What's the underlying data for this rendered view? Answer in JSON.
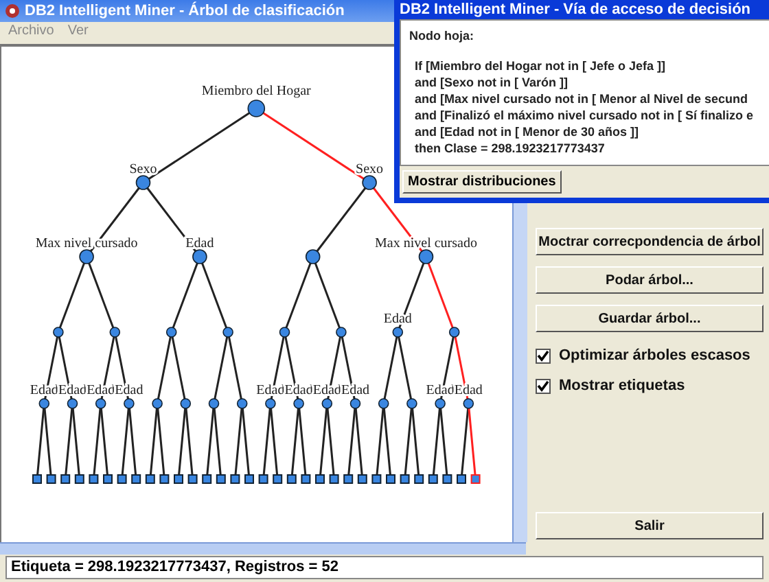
{
  "window": {
    "title": "DB2 Intelligent Miner - Árbol de clasificación"
  },
  "menu": [
    "Archivo",
    "Ver"
  ],
  "tree": {
    "label": "Miembro del Hogar",
    "children": [
      {
        "label": "Sexo",
        "path": false,
        "children": [
          {
            "label": "Max nivel cursado",
            "path": false,
            "children": [
              {
                "path": false,
                "children": [
                  {
                    "label": "Edad",
                    "path": false,
                    "children": [
                      {
                        "path": false
                      },
                      {
                        "path": false
                      }
                    ]
                  },
                  {
                    "label": "Edad",
                    "path": false,
                    "children": [
                      {
                        "path": false
                      },
                      {
                        "path": false
                      }
                    ]
                  }
                ]
              },
              {
                "path": false,
                "children": [
                  {
                    "label": "Edad",
                    "path": false,
                    "children": [
                      {
                        "path": false
                      },
                      {
                        "path": false
                      }
                    ]
                  },
                  {
                    "label": "Edad",
                    "path": false,
                    "children": [
                      {
                        "path": false
                      },
                      {
                        "path": false
                      }
                    ]
                  }
                ]
              }
            ]
          },
          {
            "label": "Edad",
            "path": false,
            "children": [
              {
                "path": false,
                "children": [
                  {
                    "path": false,
                    "children": [
                      {
                        "path": false
                      },
                      {
                        "path": false
                      }
                    ]
                  },
                  {
                    "path": false,
                    "children": [
                      {
                        "path": false
                      },
                      {
                        "path": false
                      }
                    ]
                  }
                ]
              },
              {
                "path": false,
                "children": [
                  {
                    "path": false,
                    "children": [
                      {
                        "path": false
                      },
                      {
                        "path": false
                      }
                    ]
                  },
                  {
                    "path": false,
                    "children": [
                      {
                        "path": false
                      },
                      {
                        "path": false
                      }
                    ]
                  }
                ]
              }
            ]
          }
        ]
      },
      {
        "label": "Sexo",
        "path": true,
        "children": [
          {
            "path": false,
            "children": [
              {
                "path": false,
                "children": [
                  {
                    "label": "Edad",
                    "path": false,
                    "children": [
                      {
                        "path": false
                      },
                      {
                        "path": false
                      }
                    ]
                  },
                  {
                    "label": "Edad",
                    "path": false,
                    "children": [
                      {
                        "path": false
                      },
                      {
                        "path": false
                      }
                    ]
                  }
                ]
              },
              {
                "path": false,
                "children": [
                  {
                    "label": "Edad",
                    "path": false,
                    "children": [
                      {
                        "path": false
                      },
                      {
                        "path": false
                      }
                    ]
                  },
                  {
                    "label": "Edad",
                    "path": false,
                    "children": [
                      {
                        "path": false
                      },
                      {
                        "path": false
                      }
                    ]
                  }
                ]
              }
            ]
          },
          {
            "label": "Max nivel cursado",
            "path": true,
            "children": [
              {
                "label": "Edad",
                "path": false,
                "children": [
                  {
                    "path": false,
                    "children": [
                      {
                        "path": false
                      },
                      {
                        "path": false
                      }
                    ]
                  },
                  {
                    "path": false,
                    "children": [
                      {
                        "path": false
                      },
                      {
                        "path": false
                      }
                    ]
                  }
                ]
              },
              {
                "path": true,
                "children": [
                  {
                    "label": "Edad",
                    "path": false,
                    "children": [
                      {
                        "path": false
                      },
                      {
                        "path": false
                      }
                    ]
                  },
                  {
                    "label": "Edad",
                    "path": true,
                    "children": [
                      {
                        "path": false
                      },
                      {
                        "path": true
                      }
                    ]
                  }
                ]
              }
            ]
          }
        ]
      }
    ]
  },
  "panel": {
    "buttons": [
      "Moctrar correcpondencia de árbol",
      "Podar árbol...",
      "Guardar árbol..."
    ],
    "options": [
      {
        "label": "Optimizar árboles escasos",
        "checked": true
      },
      {
        "label": "Mostrar etiquetas",
        "checked": true
      }
    ],
    "exit": "Salir"
  },
  "status_bar": "Etiqueta = 298.1923217773437, Registros = 52",
  "dialog": {
    "title": "DB2 Intelligent Miner - Vía de acceso de decisión",
    "heading": "Nodo hoja:",
    "lines": [
      "If [Miembro del Hogar not in [ Jefe o Jefa ]]",
      "and [Sexo not in [ Varón ]]",
      "and [Max nivel cursado not in [ Menor al Nivel de secund",
      "and [Finalizó el máximo nivel cursado not in [ Sí finalizo e",
      "and [Edad not in [ Menor de 30 años ]]",
      "then Clase = 298.1923217773437"
    ],
    "button": "Mostrar distribuciones"
  }
}
